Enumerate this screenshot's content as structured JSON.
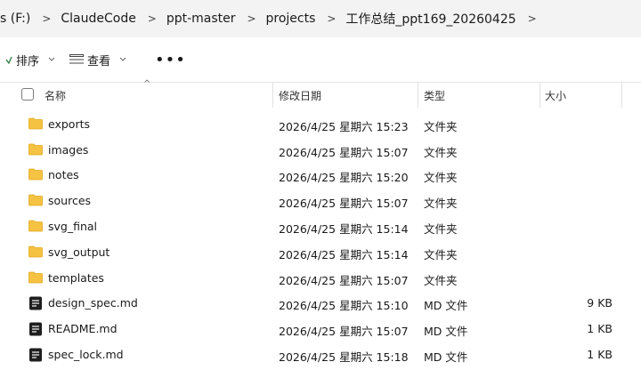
{
  "breadcrumb": [
    "s (F:)",
    "ClaudeCode",
    "ppt-master",
    "projects",
    "工作总结_ppt169_20260425"
  ],
  "toolbar": {
    "sort_label": "排序",
    "view_label": "查看",
    "more_label": "•••"
  },
  "columns": {
    "name": "名称",
    "date": "修改日期",
    "type": "类型",
    "size": "大小"
  },
  "files": [
    {
      "name": "exports",
      "date": "2026/4/25 星期六 15:23",
      "type": "文件夹",
      "size": "",
      "icon": "folder-icon"
    },
    {
      "name": "images",
      "date": "2026/4/25 星期六 15:07",
      "type": "文件夹",
      "size": "",
      "icon": "folder-icon"
    },
    {
      "name": "notes",
      "date": "2026/4/25 星期六 15:20",
      "type": "文件夹",
      "size": "",
      "icon": "folder-icon"
    },
    {
      "name": "sources",
      "date": "2026/4/25 星期六 15:07",
      "type": "文件夹",
      "size": "",
      "icon": "folder-icon"
    },
    {
      "name": "svg_final",
      "date": "2026/4/25 星期六 15:14",
      "type": "文件夹",
      "size": "",
      "icon": "folder-icon"
    },
    {
      "name": "svg_output",
      "date": "2026/4/25 星期六 15:14",
      "type": "文件夹",
      "size": "",
      "icon": "folder-icon"
    },
    {
      "name": "templates",
      "date": "2026/4/25 星期六 15:07",
      "type": "文件夹",
      "size": "",
      "icon": "folder-icon"
    },
    {
      "name": "design_spec.md",
      "date": "2026/4/25 星期六 15:10",
      "type": "MD 文件",
      "size": "9 KB",
      "icon": "markdown-file-icon"
    },
    {
      "name": "README.md",
      "date": "2026/4/25 星期六 15:07",
      "type": "MD 文件",
      "size": "1 KB",
      "icon": "markdown-file-icon"
    },
    {
      "name": "spec_lock.md",
      "date": "2026/4/25 星期六 15:18",
      "type": "MD 文件",
      "size": "1 KB",
      "icon": "markdown-file-icon"
    }
  ],
  "colors": {
    "folder": "#f5c242",
    "folder_dark": "#e3a81d",
    "breadcrumb_bg": "#f3f3f3"
  }
}
